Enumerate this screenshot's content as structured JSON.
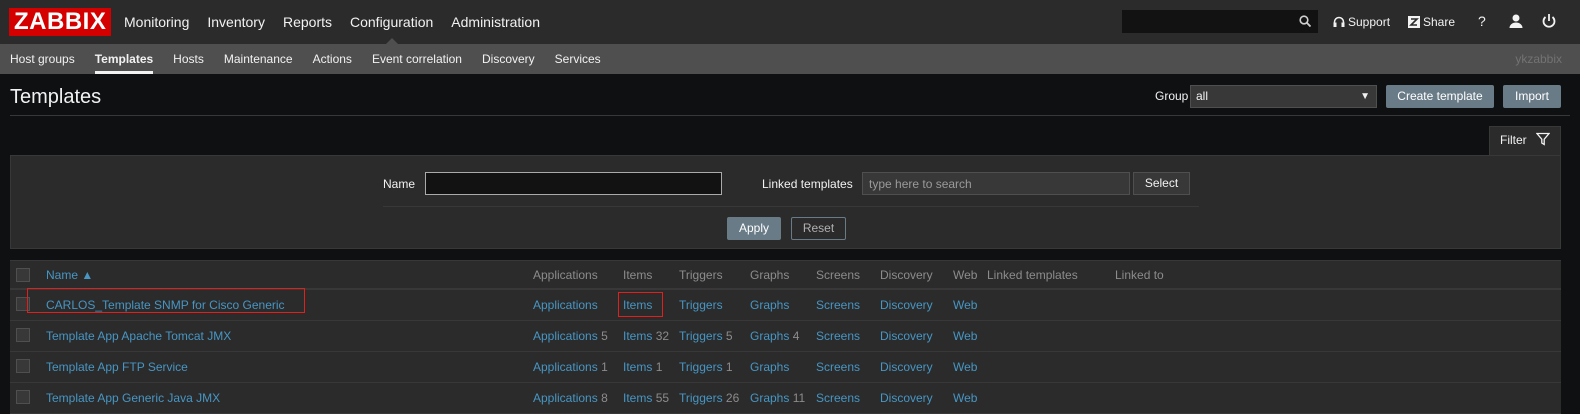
{
  "app": {
    "logo": "ZABBIX",
    "username": "ykzabbix"
  },
  "main_nav": [
    {
      "label": "Monitoring",
      "active": false
    },
    {
      "label": "Inventory",
      "active": false
    },
    {
      "label": "Reports",
      "active": false
    },
    {
      "label": "Configuration",
      "active": true
    },
    {
      "label": "Administration",
      "active": false
    }
  ],
  "top_right": {
    "search_value": "",
    "support_label": "Support",
    "share_label": "Share",
    "help_label": "?"
  },
  "sub_nav": [
    {
      "label": "Host groups",
      "active": false
    },
    {
      "label": "Templates",
      "active": true
    },
    {
      "label": "Hosts",
      "active": false
    },
    {
      "label": "Maintenance",
      "active": false
    },
    {
      "label": "Actions",
      "active": false
    },
    {
      "label": "Event correlation",
      "active": false
    },
    {
      "label": "Discovery",
      "active": false
    },
    {
      "label": "Services",
      "active": false
    }
  ],
  "header": {
    "title": "Templates",
    "group_label": "Group",
    "group_value": "all",
    "create_label": "Create template",
    "import_label": "Import"
  },
  "filter": {
    "tab_label": "Filter",
    "name_label": "Name",
    "name_value": "",
    "linked_label": "Linked templates",
    "linked_placeholder": "type here to search",
    "select_label": "Select",
    "apply_label": "Apply",
    "reset_label": "Reset"
  },
  "table": {
    "headers": {
      "name": "Name ▲",
      "applications": "Applications",
      "items": "Items",
      "triggers": "Triggers",
      "graphs": "Graphs",
      "screens": "Screens",
      "discovery": "Discovery",
      "web": "Web",
      "linked_templates": "Linked templates",
      "linked_to": "Linked to"
    },
    "rows": [
      {
        "name": "CARLOS_Template SNMP for Cisco Generic",
        "applications": "Applications",
        "applications_count": "",
        "items": "Items",
        "items_count": "",
        "triggers": "Triggers",
        "triggers_count": "",
        "graphs": "Graphs",
        "graphs_count": "",
        "screens": "Screens",
        "discovery": "Discovery",
        "web": "Web"
      },
      {
        "name": "Template App Apache Tomcat JMX",
        "applications": "Applications",
        "applications_count": "5",
        "items": "Items",
        "items_count": "32",
        "triggers": "Triggers",
        "triggers_count": "5",
        "graphs": "Graphs",
        "graphs_count": "4",
        "screens": "Screens",
        "discovery": "Discovery",
        "web": "Web"
      },
      {
        "name": "Template App FTP Service",
        "applications": "Applications",
        "applications_count": "1",
        "items": "Items",
        "items_count": "1",
        "triggers": "Triggers",
        "triggers_count": "1",
        "graphs": "Graphs",
        "graphs_count": "",
        "screens": "Screens",
        "discovery": "Discovery",
        "web": "Web"
      },
      {
        "name": "Template App Generic Java JMX",
        "applications": "Applications",
        "applications_count": "8",
        "items": "Items",
        "items_count": "55",
        "triggers": "Triggers",
        "triggers_count": "26",
        "graphs": "Graphs",
        "graphs_count": "11",
        "screens": "Screens",
        "discovery": "Discovery",
        "web": "Web"
      }
    ]
  },
  "colors": {
    "brand": "#d40000",
    "link": "#4796c4",
    "highlight_box": "#e0201c"
  }
}
